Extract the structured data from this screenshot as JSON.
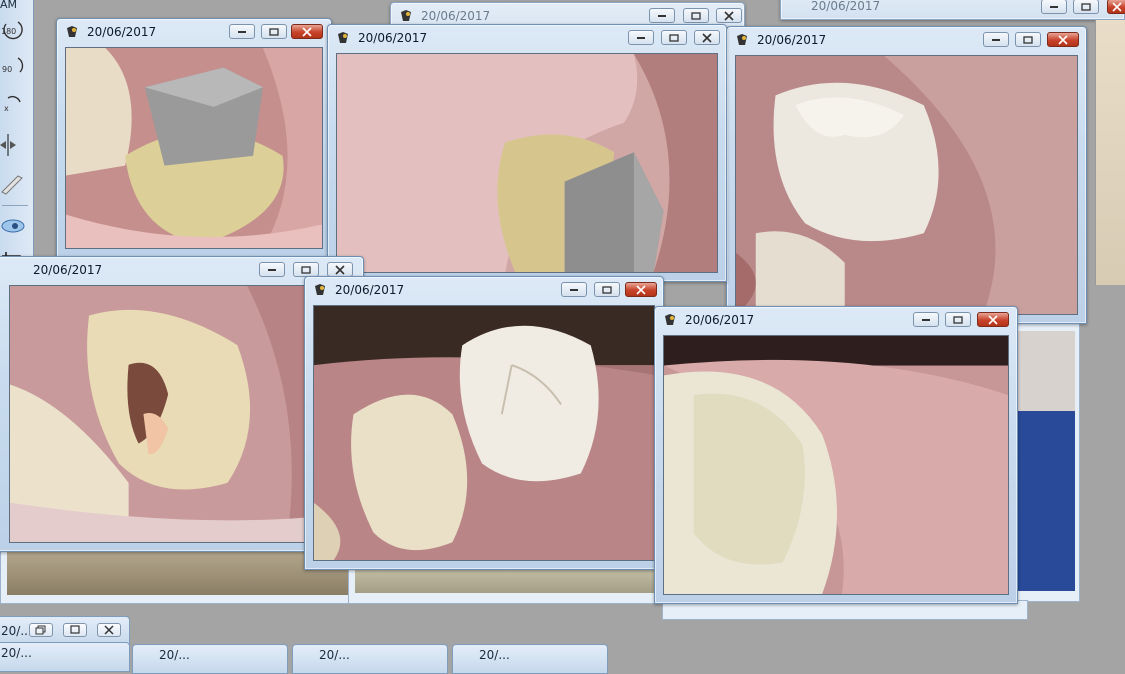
{
  "toolbar": {
    "title_fragment": "AM",
    "tools": [
      {
        "name": "rotate-180-tool",
        "label": "180"
      },
      {
        "name": "rotate-90-tool",
        "label": "90"
      },
      {
        "name": "rotate-custom-tool",
        "label": "x"
      },
      {
        "name": "mirror-tool",
        "label": ""
      },
      {
        "name": "pen-tool",
        "label": ""
      },
      {
        "name": "view-tool",
        "label": ""
      },
      {
        "name": "crop-tool",
        "label": ""
      },
      {
        "name": "select-tool",
        "label": ""
      },
      {
        "name": "lips-tool",
        "label": ""
      }
    ]
  },
  "windows": [
    {
      "id": "w-back-1",
      "title": "20/06/2017"
    },
    {
      "id": "w-back-2",
      "title": "20/06/2017"
    },
    {
      "id": "w-back-3",
      "title": "20/06/2017"
    },
    {
      "id": "w-cap-abutment",
      "title": "20/06/2017"
    },
    {
      "id": "w-abutment-side",
      "title": "20/06/2017"
    },
    {
      "id": "w-crown-molar",
      "title": "20/06/2017"
    },
    {
      "id": "w-rootcanal",
      "title": "20/06/2017"
    },
    {
      "id": "w-two-crowns",
      "title": "20/06/2017"
    },
    {
      "id": "w-crown-closeup",
      "title": "20/06/2017"
    }
  ],
  "taskbar": [
    {
      "label": "20/..."
    },
    {
      "label": "20/..."
    },
    {
      "label": "20/..."
    },
    {
      "label": "20/..."
    },
    {
      "label": "20/..."
    }
  ],
  "colors": {
    "title_active": "#dde9f6",
    "close_red": "#c8432a",
    "desktop_gray": "#a4a4a4"
  }
}
